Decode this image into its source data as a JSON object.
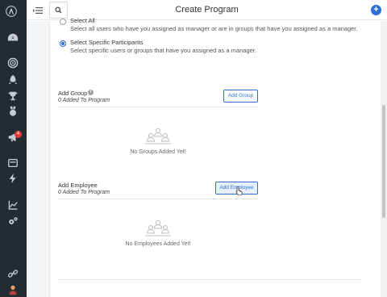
{
  "header": {
    "title": "Create Program",
    "plus_label": "+"
  },
  "notifications": {
    "count": "4"
  },
  "participants": {
    "select_all": {
      "label": "Select All",
      "description": "Select all users who have you assigned as manager or are in groups that have you assigned as a manager."
    },
    "select_specific": {
      "label": "Select Specific Participants",
      "description": "Select specific users or groups that have you assigned as a manager."
    }
  },
  "groups": {
    "title": "Add Group",
    "info_glyph": "i",
    "added": "0 Added To Program",
    "button": "Add Group",
    "empty": "No Groups Added Yet!"
  },
  "employees": {
    "title": "Add Employee",
    "added": "0 Added To Program",
    "button": "Add Employee",
    "empty": "No Employees Added Yet!"
  },
  "sidebar_icons": [
    "logo-icon",
    "dashboard-icon",
    "target-icon",
    "rocket-icon",
    "trophy-icon",
    "medal-icon",
    "megaphone-icon",
    "card-icon",
    "bolt-icon",
    "chart-icon",
    "gears-icon",
    "link-icon",
    "user-avatar"
  ]
}
